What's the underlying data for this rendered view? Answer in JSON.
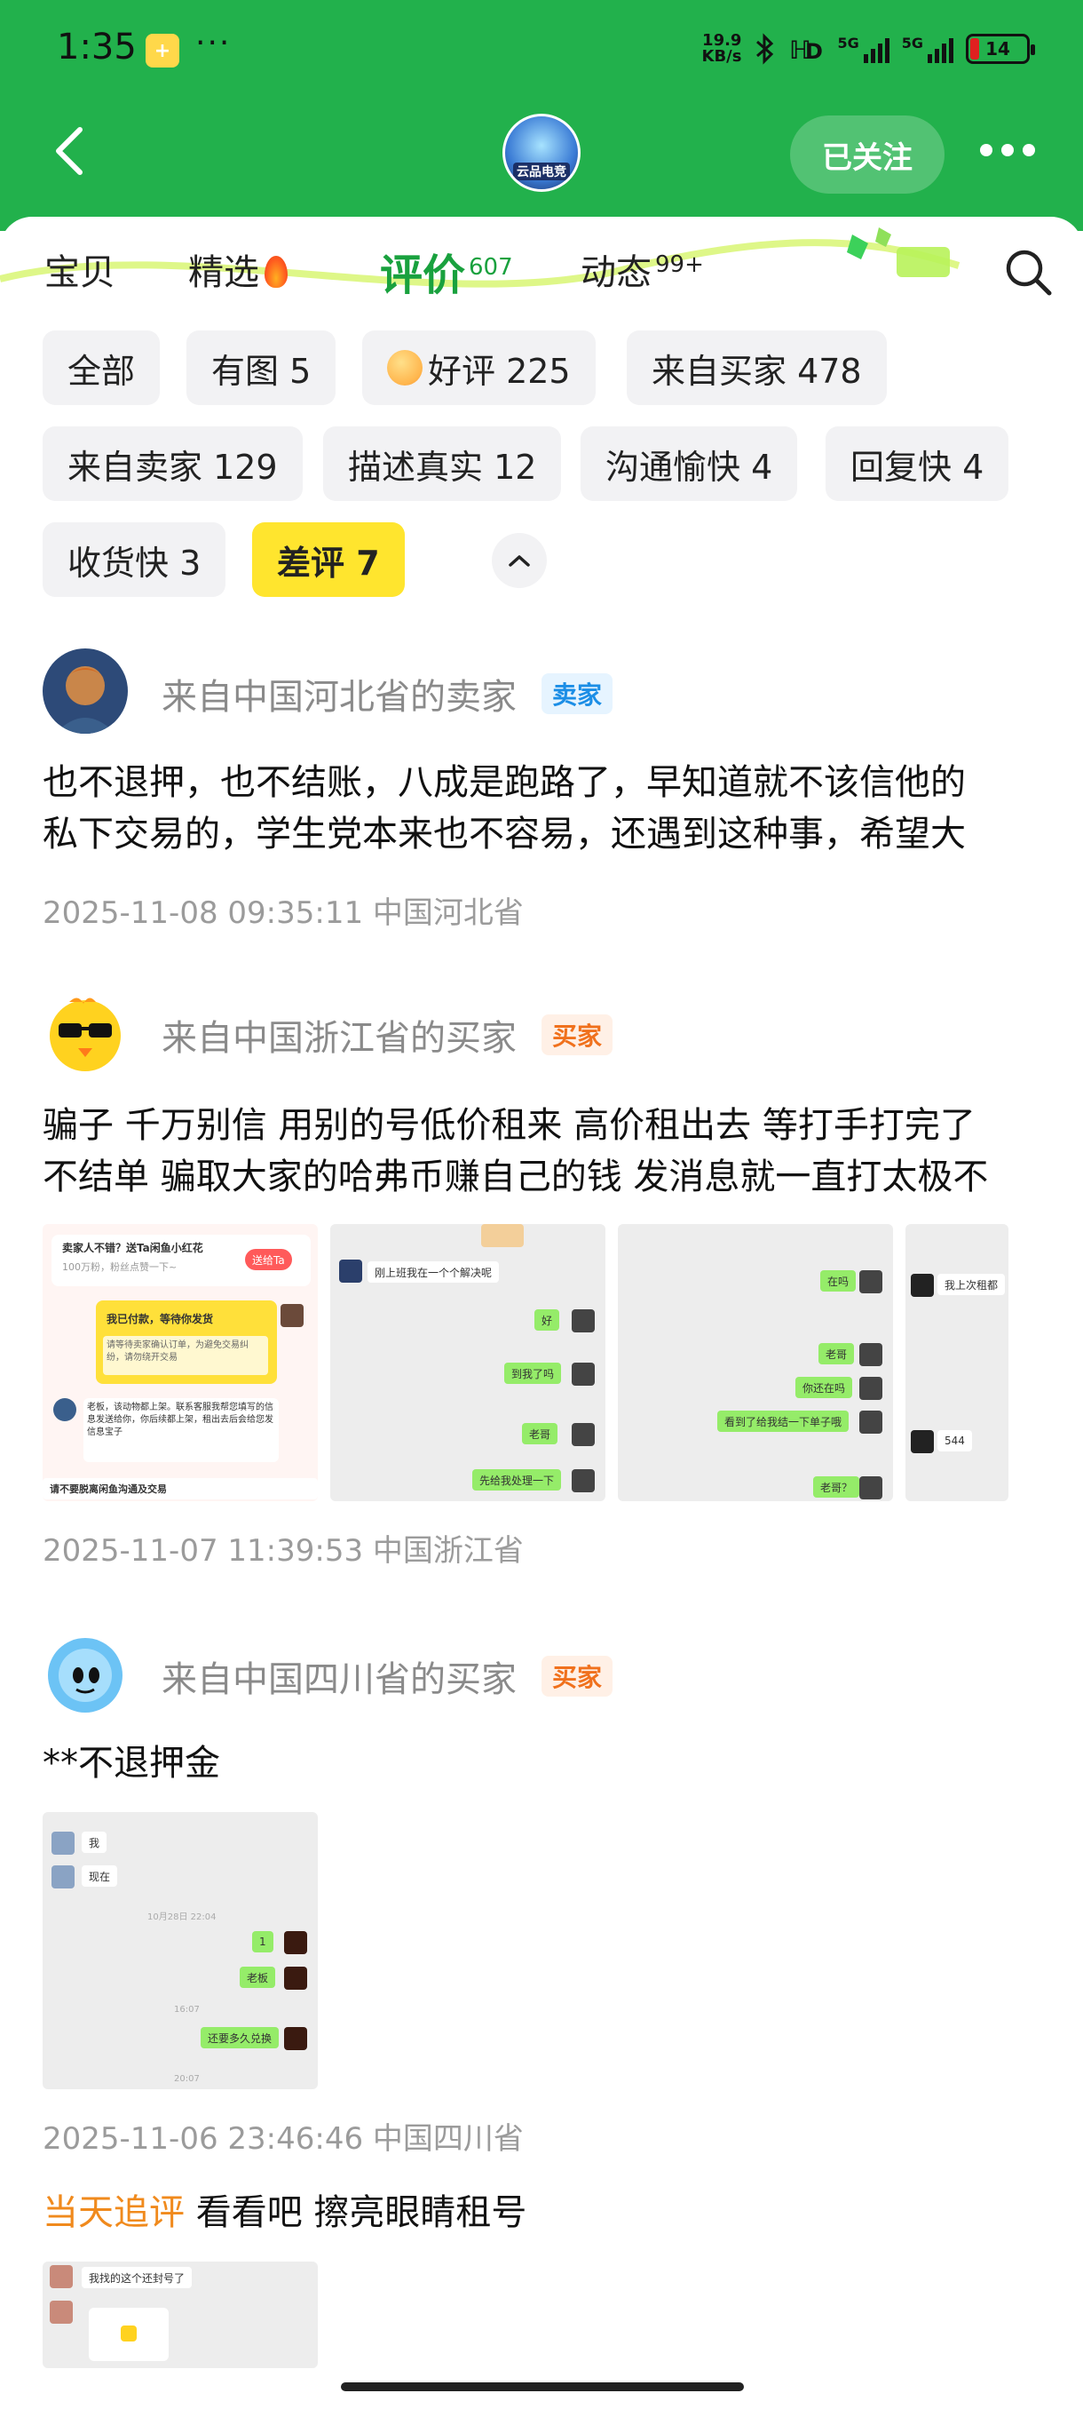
{
  "status_bar": {
    "time": "1:35",
    "dots": "···",
    "net_speed": "19.9",
    "net_unit": "KB/s",
    "network": "5G",
    "battery": "14"
  },
  "header": {
    "avatar_text": "云品电竞",
    "follow_label": "已关注"
  },
  "tabs": [
    {
      "label": "宝贝",
      "count": ""
    },
    {
      "label": "精选",
      "count": ""
    },
    {
      "label": "评价",
      "count": "607"
    },
    {
      "label": "动态",
      "count": "99+"
    }
  ],
  "filters": [
    {
      "label": "全部"
    },
    {
      "label": "有图 5"
    },
    {
      "label": "好评 225"
    },
    {
      "label": "来自买家 478"
    },
    {
      "label": "来自卖家 129"
    },
    {
      "label": "描述真实 12"
    },
    {
      "label": "沟通愉快 4"
    },
    {
      "label": "回复快 4"
    },
    {
      "label": "收货快 3"
    },
    {
      "label": "差评 7"
    }
  ],
  "reviews": [
    {
      "name": "来自中国河北省的卖家",
      "role": "卖家",
      "text_line1": "也不退押，也不结账，八成是跑路了，早知道就不该信他的",
      "text_line2": "私下交易的，学生党本来也不容易，还遇到这种事，希望大",
      "meta": "2025-11-08 09:35:11  中国河北省"
    },
    {
      "name": "来自中国浙江省的买家",
      "role": "买家",
      "text_line1": "骗子 千万别信 用别的号低价租来 高价租出去 等打手打完了",
      "text_line2": "不结单 骗取大家的哈弗币赚自己的钱 发消息就一直打太极不",
      "meta": "2025-11-07 11:39:53  中国浙江省",
      "thumb1": {
        "header": "卖家人不错？送Ta闲鱼小红花",
        "sub": "100万粉，粉丝点赞一下~",
        "button": "送给Ta",
        "paid": "我已付款，等待你发货",
        "paid_sub": "请等待卖家确认订单，为避免交易纠纷，请勿绕开交易",
        "msg": "老板，该动物都上架。联系客服我帮您填写的信息发送给你，你后续都上架，租出去后会给您发信息宝子",
        "warn": "请不要脱离闲鱼沟通及交易"
      },
      "thumb2": {
        "m1": "刚上班我在一个个解决呢",
        "m2": "好",
        "m3": "到我了吗",
        "m4": "老哥",
        "m5": "先给我处理一下"
      },
      "thumb3": {
        "m1": "在吗",
        "m2": "老哥",
        "m3": "你还在吗",
        "m4": "看到了给我结一下单子哦",
        "m5": "老哥？"
      },
      "thumb4": {
        "m1": "我上次租都",
        "m2": "544"
      }
    },
    {
      "name": "来自中国四川省的买家",
      "role": "买家",
      "text_line1": "**不退押金",
      "meta": "2025-11-06 23:46:46  中国四川省",
      "thumb": {
        "m1": "我",
        "m2": "现在",
        "time1": "10月28日 22:04",
        "m3": "1",
        "m4": "老板",
        "time2": "16:07",
        "m5": "还要多久兑换",
        "time3": "20:07"
      },
      "followup_tag": "当天追评",
      "followup_text": " 看看吧 擦亮眼睛租号",
      "followup_thumb": {
        "m1": "我找的这个还封号了"
      }
    }
  ],
  "colors": {
    "brand_green": "#22b14c",
    "active_chip": "#ffe52e",
    "seller_tag": "#1c8ee6",
    "buyer_tag": "#f0711d"
  }
}
